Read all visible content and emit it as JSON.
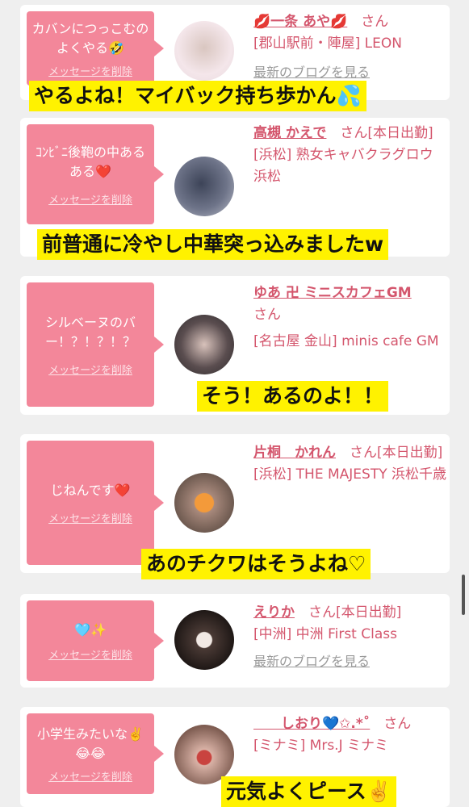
{
  "items": [
    {
      "message": "カバンにつっこむのよくやる🤣",
      "delete": "メッセージを削除",
      "name": "💋一条 あや💋",
      "honorific": "さん",
      "location": "[郡山駅前・陣屋] LEON",
      "blog": "最新のブログを見る",
      "caption": "やるよね！マイバック持ち歩かん💦"
    },
    {
      "message": "ｺﾝﾋﾞﾆ後鞄の中あるある❤️",
      "delete": "メッセージを削除",
      "name": "高槻 かえで",
      "honorific": "さん[本日出勤]",
      "location": "[浜松] 熟女キャバクラグロウ 浜松",
      "caption": "前普通に冷やし中華突っ込みましたw"
    },
    {
      "message": "シルベーヌのバー！？！？！？",
      "delete": "メッセージを削除",
      "name": "ゆあ 卍 ミニスカフェGM",
      "honorific": "さん",
      "location": "[名古屋 金山] minis cafe GM",
      "caption": "そう！あるのよ！！"
    },
    {
      "message": "じねんです❤️",
      "delete": "メッセージを削除",
      "name": "片桐　かれん",
      "honorific": "さん[本日出勤]",
      "location": "[浜松] THE MAJESTY 浜松千歳",
      "caption": "あのチクワはそうよね♡"
    },
    {
      "message": "🩵✨",
      "delete": "メッセージを削除",
      "name": "えりか",
      "honorific": "さん[本日出勤]",
      "location": "[中洲] 中洲 First Class",
      "blog": "最新のブログを見る"
    },
    {
      "message": "小学生みたいな✌️😂😂",
      "delete": "メッセージを削除",
      "name": "　　しおり💙✩.*˚",
      "honorific": "さん",
      "location": "[ミナミ] Mrs.J ミナミ",
      "caption": "元気よくピース✌️"
    }
  ]
}
